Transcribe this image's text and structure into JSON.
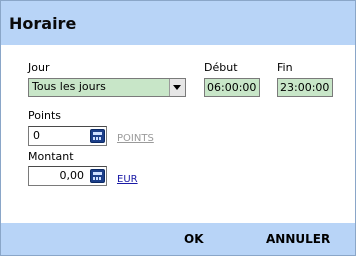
{
  "dialog": {
    "title": "Horaire"
  },
  "form": {
    "day_label": "Jour",
    "day_value": "Tous les jours",
    "start_label": "Début",
    "start_value": "06:00:00",
    "end_label": "Fin",
    "end_value": "23:00:00",
    "points_label": "Points",
    "points_value": "0",
    "points_unit": "POINTS",
    "amount_label": "Montant",
    "amount_value": "0,00",
    "amount_unit": "EUR"
  },
  "footer": {
    "ok_label": "OK",
    "cancel_label": "ANNULER"
  },
  "colors": {
    "header_bg": "#b8d4f7",
    "field_bg": "#c8e6c8",
    "link_gray": "#9a9a9a",
    "link_blue": "#1a1aa6"
  }
}
